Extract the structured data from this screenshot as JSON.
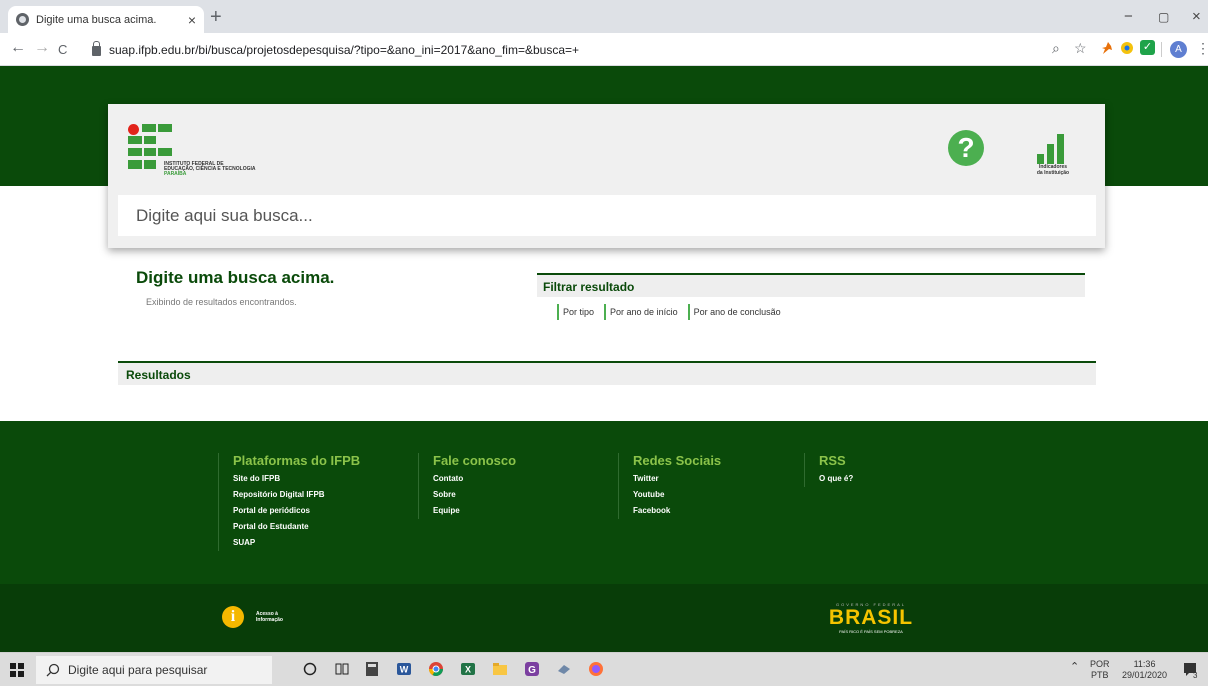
{
  "browser": {
    "tab_title": "Digite uma busca acima.",
    "tab_close": "×",
    "new_tab": "+",
    "url": "suap.ifpb.edu.br/bi/busca/projetosdepesquisa/?tipo=&ano_ini=2017&ano_fim=&busca=+",
    "back": "←",
    "forward": "→",
    "reload": "C",
    "zoom": "⌕",
    "star": "☆",
    "ext_check": "✓",
    "avatar_letter": "A",
    "menu": "⋮",
    "window_min": "−",
    "window_max": "▢",
    "window_close": "×"
  },
  "header": {
    "logo_line1": "INSTITUTO FEDERAL DE",
    "logo_line2": "EDUCAÇÃO, CIÊNCIA E TECNOLOGIA",
    "logo_line3": "PARAÍBA",
    "help_symbol": "?",
    "indicators_line1": "Indicadores",
    "indicators_line2": "da Instituição",
    "search_placeholder": "Digite aqui sua busca..."
  },
  "main": {
    "heading": "Digite uma busca acima.",
    "subheading": "Exibindo de resultados encontrandos.",
    "filter_title": "Filtrar resultado",
    "filters": [
      "Por tipo",
      "Por ano de início",
      "Por ano de conclusão"
    ],
    "results_title": "Resultados"
  },
  "footer": {
    "columns": [
      {
        "title": "Plataformas do IFPB",
        "links": [
          "Site do IFPB",
          "Repositório Digital IFPB",
          "Portal de periódicos",
          "Portal do Estudante",
          "SUAP"
        ]
      },
      {
        "title": "Fale conosco",
        "links": [
          "Contato",
          "Sobre",
          "Equipe"
        ]
      },
      {
        "title": "Redes Sociais",
        "links": [
          "Twitter",
          "Youtube",
          "Facebook"
        ]
      },
      {
        "title": "RSS",
        "links": [
          "O que é?"
        ]
      }
    ],
    "acesso_line1": "Acesso à",
    "acesso_line2": "Informação",
    "acesso_symbol": "i",
    "brasil_top": "GOVERNO FEDERAL",
    "brasil_word": "BRASIL",
    "brasil_sub": "PAÍS RICO É PAÍS SEM POBREZA"
  },
  "taskbar": {
    "search_placeholder": "Digite aqui para pesquisar",
    "language_line1": "POR",
    "language_line2": "PTB",
    "time": "11:36",
    "date": "29/01/2020",
    "notification_count": "3"
  },
  "colors": {
    "brand_green": "#0a4a0a",
    "accent_green": "#3a9b3a"
  }
}
